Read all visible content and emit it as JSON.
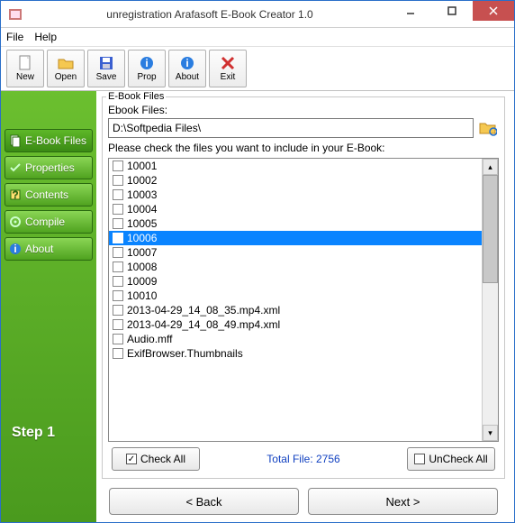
{
  "window": {
    "title": "unregistration Arafasoft E-Book Creator 1.0"
  },
  "menu": {
    "file": "File",
    "help": "Help"
  },
  "toolbar": {
    "new": "New",
    "open": "Open",
    "save": "Save",
    "prop": "Prop",
    "about": "About",
    "exit": "Exit"
  },
  "sidebar": {
    "items": [
      {
        "label": "E-Book Files"
      },
      {
        "label": "Properties"
      },
      {
        "label": "Contents"
      },
      {
        "label": "Compile"
      },
      {
        "label": "About"
      }
    ],
    "step": "Step 1"
  },
  "main": {
    "group_title": "E-Book Files",
    "path_label": "Ebook  Files:",
    "path_value": "D:\\Softpedia Files\\",
    "instruction": "Please check the files you want to include in your E-Book:",
    "files": [
      "10001",
      "10002",
      "10003",
      "10004",
      "10005",
      "10006",
      "10007",
      "10008",
      "10009",
      "10010",
      "2013-04-29_14_08_35.mp4.xml",
      "2013-04-29_14_08_49.mp4.xml",
      "Audio.mff",
      "ExifBrowser.Thumbnails"
    ],
    "selected_index": 5,
    "check_all": "Check All",
    "uncheck_all": "UnCheck All",
    "total_label": "Total File: 2756",
    "back": "< Back",
    "next": "Next >"
  }
}
